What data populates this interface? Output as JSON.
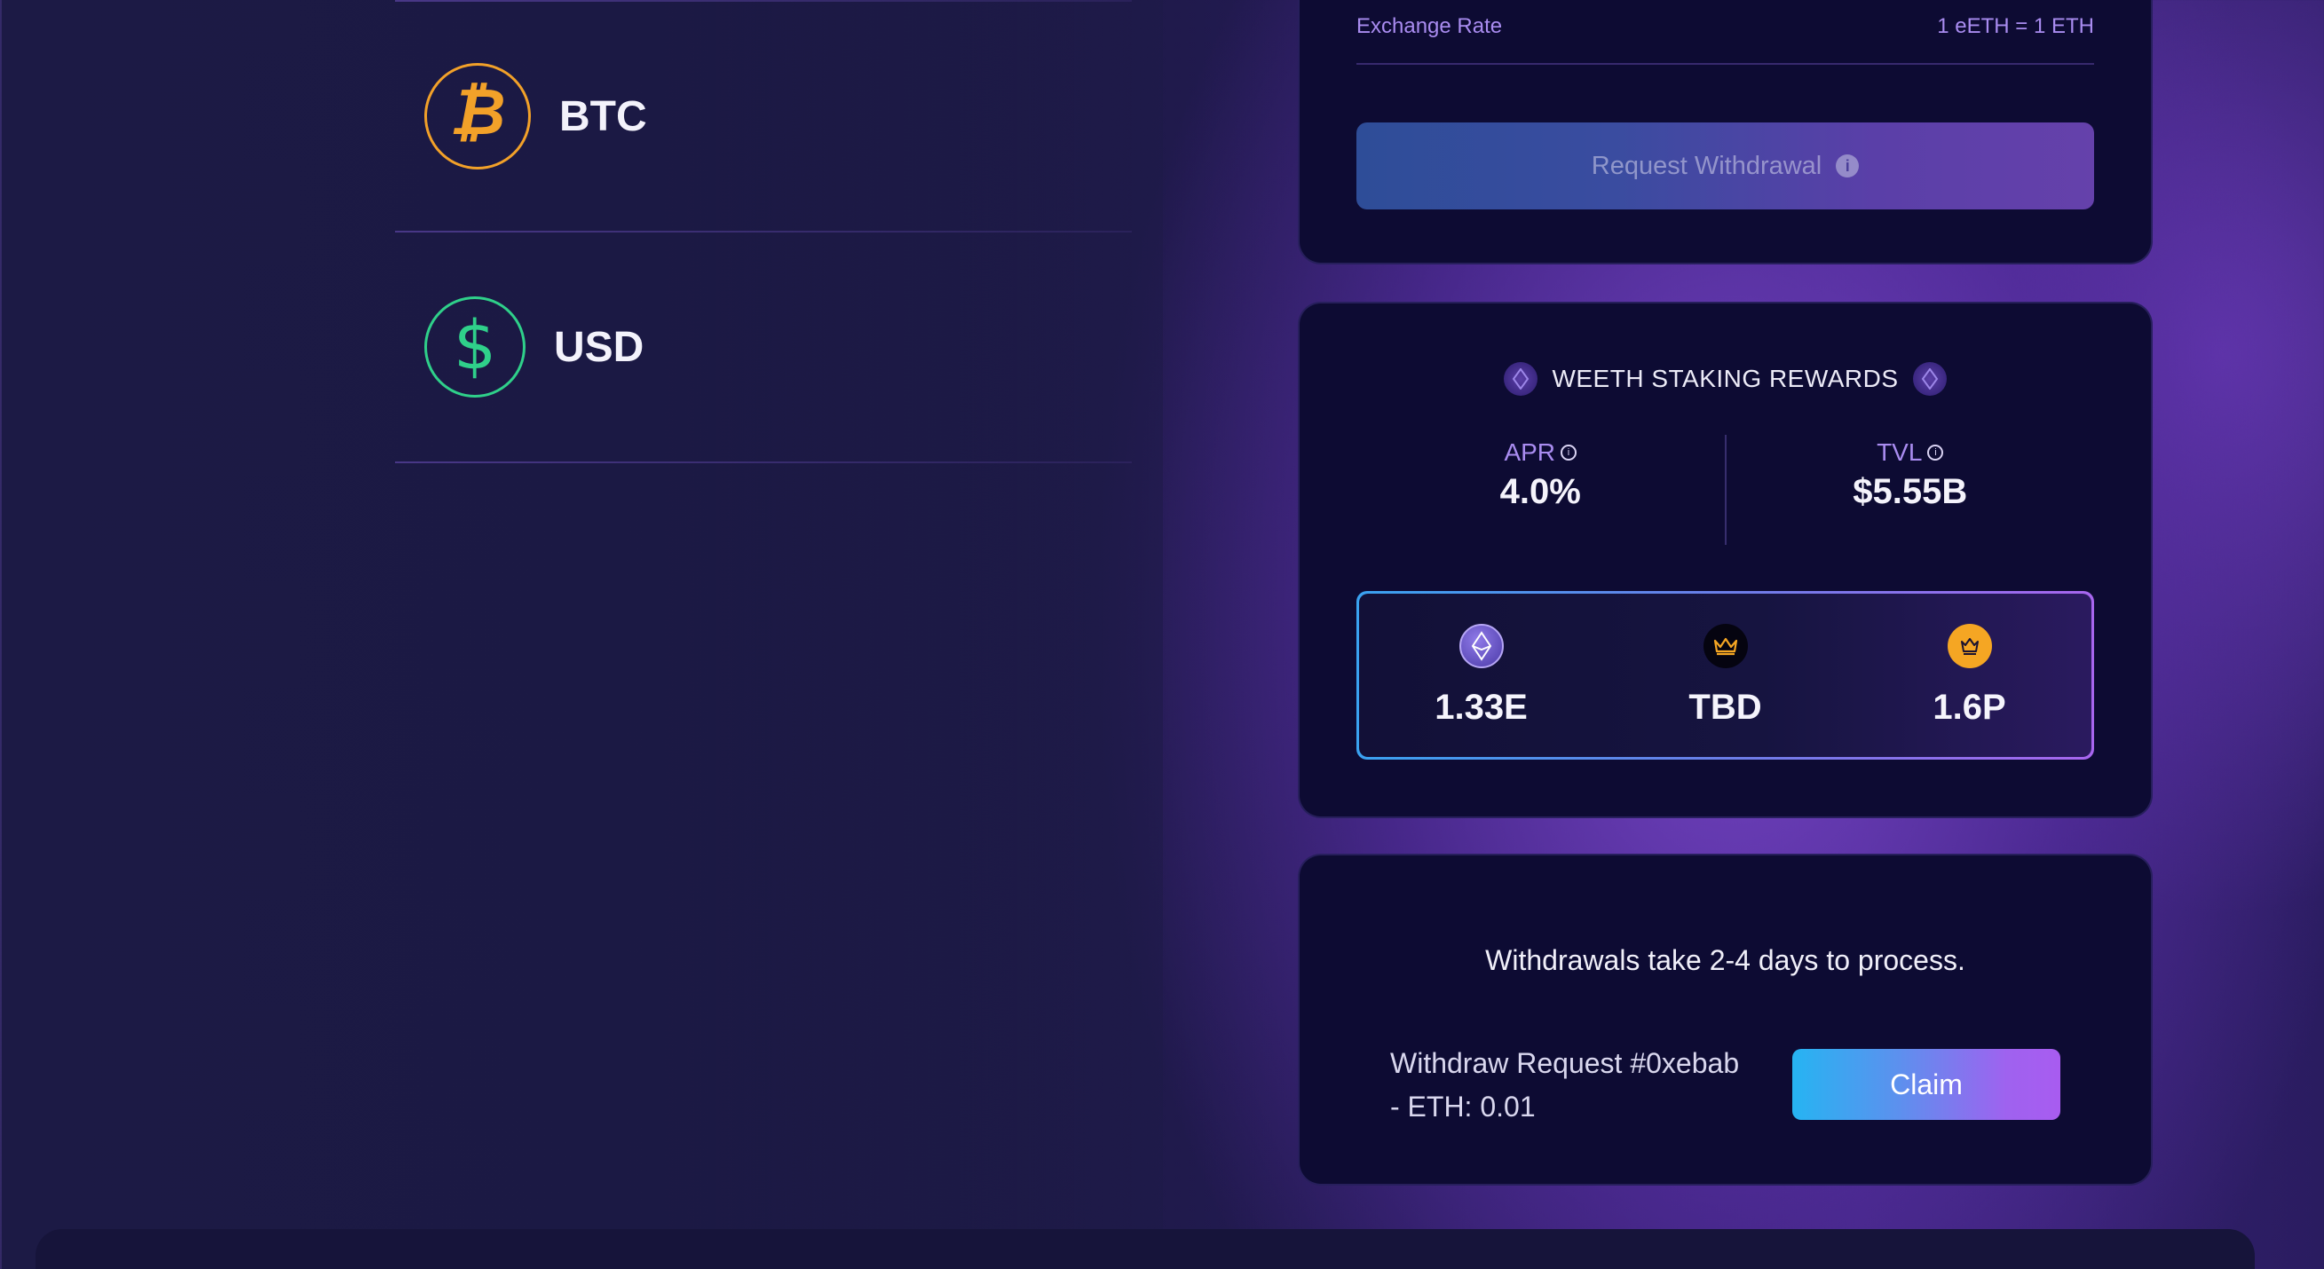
{
  "assets": [
    {
      "symbol": "BTC",
      "icon": "bitcoin-icon",
      "color": "#f2a129"
    },
    {
      "symbol": "USD",
      "icon": "dollar-icon",
      "color": "#2fd08a"
    }
  ],
  "withdraw_card": {
    "exchange_rate_label": "Exchange Rate",
    "exchange_rate_value": "1 eETH = 1 ETH",
    "request_button_label": "Request Withdrawal",
    "request_button_info_icon": "info-icon"
  },
  "rewards_card": {
    "title": "WEETH STAKING REWARDS",
    "apr_label": "APR",
    "apr_value": "4.0%",
    "tvl_label": "TVL",
    "tvl_value": "$5.55B",
    "points": [
      {
        "icon": "eth-points-icon",
        "value": "1.33E"
      },
      {
        "icon": "crown-icon",
        "value": "TBD"
      },
      {
        "icon": "king-points-icon",
        "value": "1.6P"
      }
    ]
  },
  "claim_card": {
    "note": "Withdrawals take 2-4 days to process.",
    "request_line1": "Withdraw Request #0xebab",
    "request_line2": "- ETH: 0.01",
    "claim_label": "Claim"
  },
  "colors": {
    "accent_purple": "#a98cf0",
    "card_bg": "#0d0b33",
    "claim_gradient_start": "#26b4f2",
    "claim_gradient_end": "#a85cf0"
  }
}
